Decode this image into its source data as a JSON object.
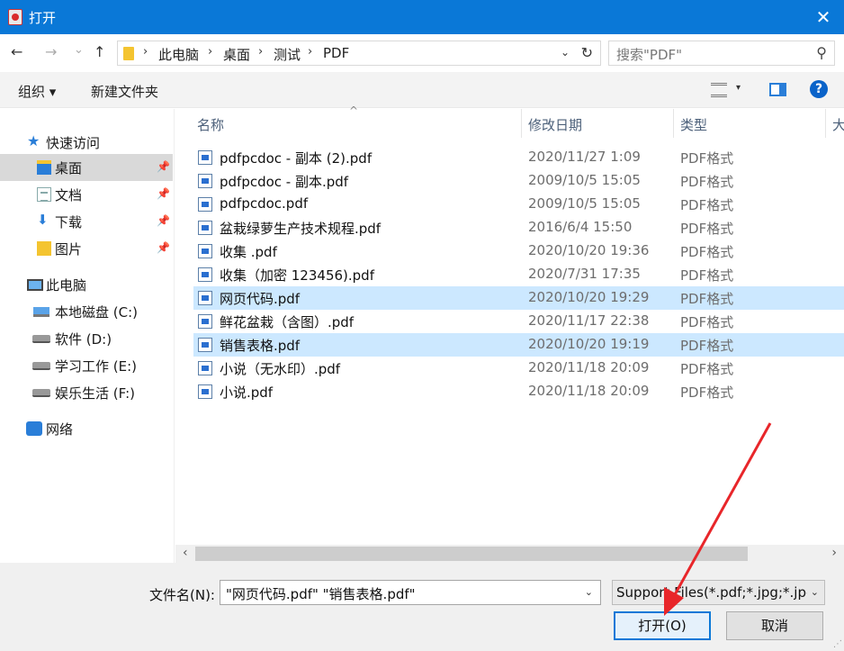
{
  "window": {
    "title": "打开",
    "close_glyph": "✕"
  },
  "address": {
    "back": "←",
    "forward": "→",
    "recent": "⌄",
    "up": "↑",
    "crumbs": [
      "此电脑",
      "桌面",
      "测试",
      "PDF"
    ],
    "separator": "›",
    "dropdown": "⌄",
    "refresh": "↻",
    "search_placeholder": "搜索\"PDF\"",
    "search_glyph": "⚲"
  },
  "toolbar": {
    "organize": "组织 ▾",
    "new_folder": "新建文件夹",
    "view_caret": "▾",
    "help": "?"
  },
  "sidebar": {
    "items": [
      {
        "label": "快速访问",
        "icon": "star-icon"
      },
      {
        "label": "桌面",
        "icon": "desktop-folder-icon",
        "pinned": true,
        "selected": true
      },
      {
        "label": "文档",
        "icon": "documents-icon",
        "pinned": true
      },
      {
        "label": "下载",
        "icon": "downloads-icon",
        "pinned": true
      },
      {
        "label": "图片",
        "icon": "pictures-icon",
        "pinned": true
      },
      {
        "label": "此电脑",
        "icon": "this-pc-icon"
      },
      {
        "label": "本地磁盘 (C:)",
        "icon": "local-disk-icon"
      },
      {
        "label": "软件 (D:)",
        "icon": "drive-icon"
      },
      {
        "label": "学习工作 (E:)",
        "icon": "drive-icon"
      },
      {
        "label": "娱乐生活 (F:)",
        "icon": "drive-icon"
      },
      {
        "label": "网络",
        "icon": "network-icon"
      }
    ],
    "pin_glyph": "📌"
  },
  "filelist": {
    "columns": [
      "名称",
      "修改日期",
      "类型",
      "大"
    ],
    "sort_glyph": "^",
    "rows": [
      {
        "name": "pdfpcdoc - 副本 (2).pdf",
        "date": "2020/11/27 1:09",
        "type": "PDF格式",
        "selected": false
      },
      {
        "name": "pdfpcdoc - 副本.pdf",
        "date": "2009/10/5 15:05",
        "type": "PDF格式",
        "selected": false
      },
      {
        "name": "pdfpcdoc.pdf",
        "date": "2009/10/5 15:05",
        "type": "PDF格式",
        "selected": false
      },
      {
        "name": "盆栽绿萝生产技术规程.pdf",
        "date": "2016/6/4 15:50",
        "type": "PDF格式",
        "selected": false
      },
      {
        "name": "收集 .pdf",
        "date": "2020/10/20 19:36",
        "type": "PDF格式",
        "selected": false
      },
      {
        "name": "收集（加密 123456).pdf",
        "date": "2020/7/31 17:35",
        "type": "PDF格式",
        "selected": false
      },
      {
        "name": "网页代码.pdf",
        "date": "2020/10/20 19:29",
        "type": "PDF格式",
        "selected": true
      },
      {
        "name": "鲜花盆栽（含图）.pdf",
        "date": "2020/11/17 22:38",
        "type": "PDF格式",
        "selected": false
      },
      {
        "name": "销售表格.pdf",
        "date": "2020/10/20 19:19",
        "type": "PDF格式",
        "selected": true
      },
      {
        "name": "小说（无水印）.pdf",
        "date": "2020/11/18 20:09",
        "type": "PDF格式",
        "selected": false
      },
      {
        "name": "小说.pdf",
        "date": "2020/11/18 20:09",
        "type": "PDF格式",
        "selected": false
      }
    ]
  },
  "scrollbar": {
    "left": "‹",
    "right": "›"
  },
  "footer": {
    "filename_label": "文件名(N):",
    "filename_value": "\"网页代码.pdf\" \"销售表格.pdf\"",
    "filetype_value": "Support Files(*.pdf;*.jpg;*.jpe",
    "caret": "⌄",
    "open_button": "打开(O)",
    "cancel_button": "取消",
    "grip": "⋰"
  },
  "colors": {
    "titlebar": "#0a78d7",
    "selection": "#cce8ff",
    "annotation_arrow": "#e8262a"
  }
}
